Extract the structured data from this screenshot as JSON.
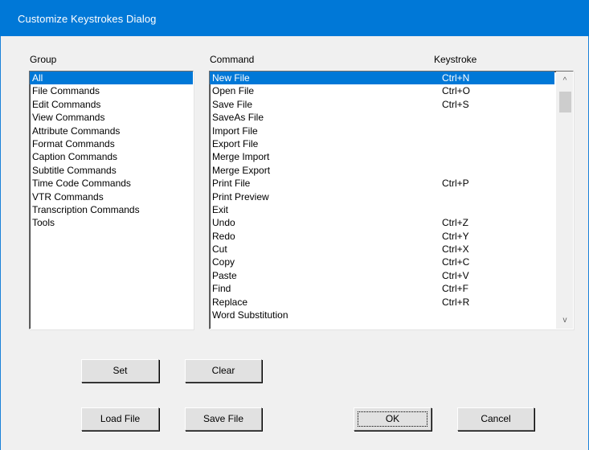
{
  "window": {
    "title": "Customize Keystrokes Dialog"
  },
  "labels": {
    "group": "Group",
    "command": "Command",
    "keystroke": "Keystroke"
  },
  "groups": [
    "All",
    "File Commands",
    "Edit Commands",
    "View Commands",
    "Attribute Commands",
    "Format Commands",
    "Caption Commands",
    "Subtitle Commands",
    "Time Code Commands",
    "VTR Commands",
    "Transcription Commands",
    "Tools"
  ],
  "selected_group": "All",
  "commands": [
    {
      "name": "New File",
      "key": "Ctrl+N"
    },
    {
      "name": "Open File",
      "key": "Ctrl+O"
    },
    {
      "name": "Save File",
      "key": "Ctrl+S"
    },
    {
      "name": "SaveAs File",
      "key": ""
    },
    {
      "name": "Import File",
      "key": ""
    },
    {
      "name": "Export File",
      "key": ""
    },
    {
      "name": "Merge Import",
      "key": ""
    },
    {
      "name": "Merge Export",
      "key": ""
    },
    {
      "name": "Print File",
      "key": "Ctrl+P"
    },
    {
      "name": "Print Preview",
      "key": ""
    },
    {
      "name": "Exit",
      "key": ""
    },
    {
      "name": "Undo",
      "key": "Ctrl+Z"
    },
    {
      "name": "Redo",
      "key": "Ctrl+Y"
    },
    {
      "name": "Cut",
      "key": "Ctrl+X"
    },
    {
      "name": "Copy",
      "key": "Ctrl+C"
    },
    {
      "name": "Paste",
      "key": "Ctrl+V"
    },
    {
      "name": "Find",
      "key": "Ctrl+F"
    },
    {
      "name": "Replace",
      "key": "Ctrl+R"
    },
    {
      "name": "Word Substitution",
      "key": ""
    }
  ],
  "selected_command": "New File",
  "scrollbar": {
    "up_arrow": "^",
    "down_arrow": "v"
  },
  "buttons": {
    "set": "Set",
    "clear": "Clear",
    "load_file": "Load File",
    "save_file": "Save File",
    "ok": "OK",
    "cancel": "Cancel"
  },
  "colors": {
    "titlebar": "#0078d7",
    "selection": "#0078d7",
    "background": "#f0f0f0"
  }
}
